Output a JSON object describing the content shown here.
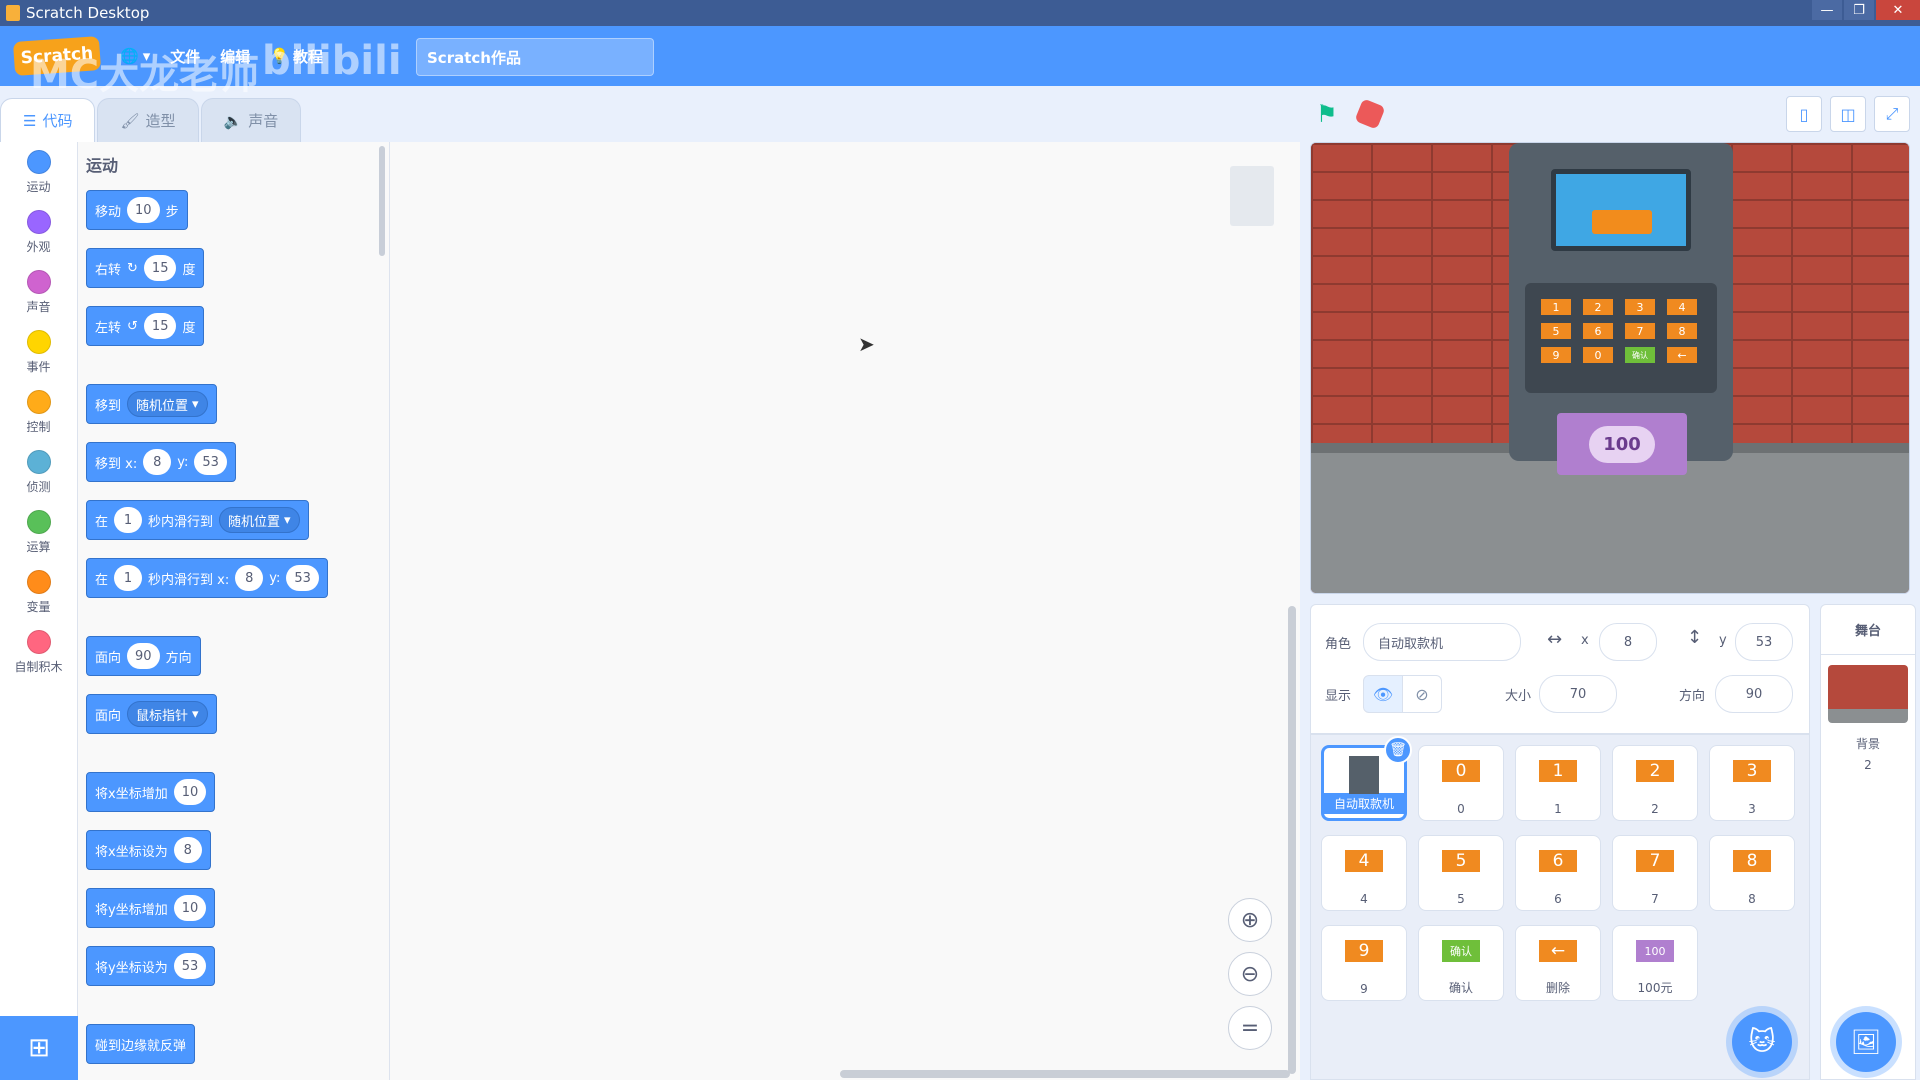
{
  "window": {
    "title": "Scratch Desktop"
  },
  "menubar": {
    "logo": "Scratch",
    "file": "文件",
    "edit": "编辑",
    "tutorials": "教程",
    "project_name": "Scratch作品",
    "watermark": "MC大龙老师",
    "watermark2": "bilibili"
  },
  "tabs": [
    {
      "label": "代码",
      "icon": "code-icon"
    },
    {
      "label": "造型",
      "icon": "brush-icon"
    },
    {
      "label": "声音",
      "icon": "speaker-icon"
    }
  ],
  "categories": [
    {
      "label": "运动",
      "color": "#4c97ff"
    },
    {
      "label": "外观",
      "color": "#9966ff"
    },
    {
      "label": "声音",
      "color": "#cf63cf"
    },
    {
      "label": "事件",
      "color": "#ffd500"
    },
    {
      "label": "控制",
      "color": "#ffab19"
    },
    {
      "label": "侦测",
      "color": "#5cb1d6"
    },
    {
      "label": "运算",
      "color": "#59c059"
    },
    {
      "label": "变量",
      "color": "#ff8c1a"
    },
    {
      "label": "自制积木",
      "color": "#ff6680"
    }
  ],
  "palette": {
    "title": "运动",
    "move": {
      "a": "移动",
      "v": "10",
      "b": "步"
    },
    "turn_right": {
      "a": "右转",
      "v": "15",
      "b": "度"
    },
    "turn_left": {
      "a": "左转",
      "v": "15",
      "b": "度"
    },
    "goto": {
      "a": "移到",
      "dd": "随机位置"
    },
    "goto_xy": {
      "a": "移到 x:",
      "x": "8",
      "yl": "y:",
      "y": "53"
    },
    "glide": {
      "a": "在",
      "v": "1",
      "b": "秒内滑行到",
      "dd": "随机位置"
    },
    "glide_xy": {
      "a": "在",
      "v": "1",
      "b": "秒内滑行到 x:",
      "x": "8",
      "yl": "y:",
      "y": "53"
    },
    "point": {
      "a": "面向",
      "v": "90",
      "b": "方向"
    },
    "point_towards": {
      "a": "面向",
      "dd": "鼠标指针"
    },
    "change_x": {
      "a": "将x坐标增加",
      "v": "10"
    },
    "set_x": {
      "a": "将x坐标设为",
      "v": "8"
    },
    "change_y": {
      "a": "将y坐标增加",
      "v": "10"
    },
    "set_y": {
      "a": "将y坐标设为",
      "v": "53"
    },
    "bounce": {
      "a": "碰到边缘就反弹"
    }
  },
  "stage_keys": [
    "1",
    "2",
    "3",
    "4",
    "5",
    "6",
    "7",
    "8",
    "9",
    "0",
    "确认",
    "←"
  ],
  "stage_note": "100",
  "sprite_info": {
    "sprite_label": "角色",
    "sprite_name": "自动取款机",
    "x_label": "x",
    "x": "8",
    "y_label": "y",
    "y": "53",
    "show_label": "显示",
    "size_label": "大小",
    "size": "70",
    "direction_label": "方向",
    "direction": "90"
  },
  "sprites": [
    {
      "name": "自动取款机",
      "thumb": "",
      "selected": true
    },
    {
      "name": "0",
      "thumb": "0"
    },
    {
      "name": "1",
      "thumb": "1"
    },
    {
      "name": "2",
      "thumb": "2"
    },
    {
      "name": "3",
      "thumb": "3"
    },
    {
      "name": "4",
      "thumb": "4"
    },
    {
      "name": "5",
      "thumb": "5"
    },
    {
      "name": "6",
      "thumb": "6"
    },
    {
      "name": "7",
      "thumb": "7"
    },
    {
      "name": "8",
      "thumb": "8"
    },
    {
      "name": "9",
      "thumb": "9"
    },
    {
      "name": "确认",
      "thumb": "确认"
    },
    {
      "name": "删除",
      "thumb": "←"
    },
    {
      "name": "100元",
      "thumb": "100"
    }
  ],
  "stage_pane": {
    "title": "舞台",
    "backdrop_label": "背景",
    "backdrop_count": "2"
  }
}
